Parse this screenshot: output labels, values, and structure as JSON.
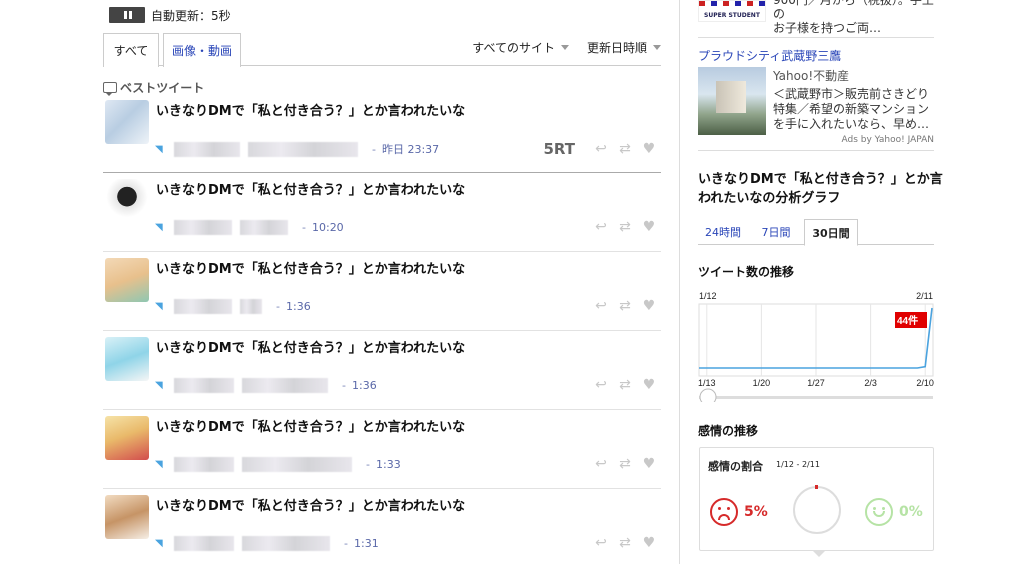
{
  "header": {
    "auto_update": "自動更新：5秒"
  },
  "tabs": {
    "all": "すべて",
    "media": "画像・動画"
  },
  "filters": {
    "site": "すべてのサイト",
    "sort": "更新日時順"
  },
  "best_label": "ベストツイート",
  "tweet_text": "いきなりDMで「私と付き合う？」とか言われたいな",
  "tweets": [
    {
      "time": "昨日 23:37",
      "rt": "5RT"
    },
    {
      "time": "10:20"
    },
    {
      "time": "1:36"
    },
    {
      "time": "1:36"
    },
    {
      "time": "1:33"
    },
    {
      "time": "1:31"
    }
  ],
  "ad": {
    "top_text_1": "900円／月から（税抜）。手土の",
    "top_text_2": "お子様を持つご両…",
    "top_img_label": "SUPER STUDENT",
    "title": "プラウドシティ武蔵野三鷹",
    "source": "Yahoo!不動産",
    "body": "＜武蔵野市＞販売前さきどり特集／希望の新築マンションを手に入れたいなら、早め…",
    "ads_by": "Ads by Yahoo! JAPAN"
  },
  "analysis": {
    "title": "いきなりDMで「私と付き合う？」とか言われたいなの分析グラフ",
    "tabs": [
      "24時間",
      "7日間",
      "30日間"
    ],
    "tweet_trend_title": "ツイート数の推移",
    "emotion_title": "感情の推移",
    "emotion_ratio_title": "感情の割合",
    "emotion_range": "1/12 - 2/11",
    "negative_pct": "5%",
    "positive_pct": "0%"
  },
  "chart_data": {
    "type": "line",
    "x_start_label": "1/12",
    "x_end_label": "2/11",
    "x_ticks": [
      "1/13",
      "1/20",
      "1/27",
      "2/3",
      "2/10"
    ],
    "x": [
      "1/12",
      "2/9",
      "2/10",
      "2/11"
    ],
    "values": [
      0,
      0,
      1,
      44
    ],
    "peak_label": "44件",
    "ylim": [
      0,
      44
    ],
    "grid": true,
    "color": "#4aa3df"
  },
  "colors": {
    "link": "#2a46b8",
    "twitter": "#4aa3df",
    "negative": "#d62a2a",
    "positive": "#b6e3a5",
    "peak": "#e00000"
  }
}
